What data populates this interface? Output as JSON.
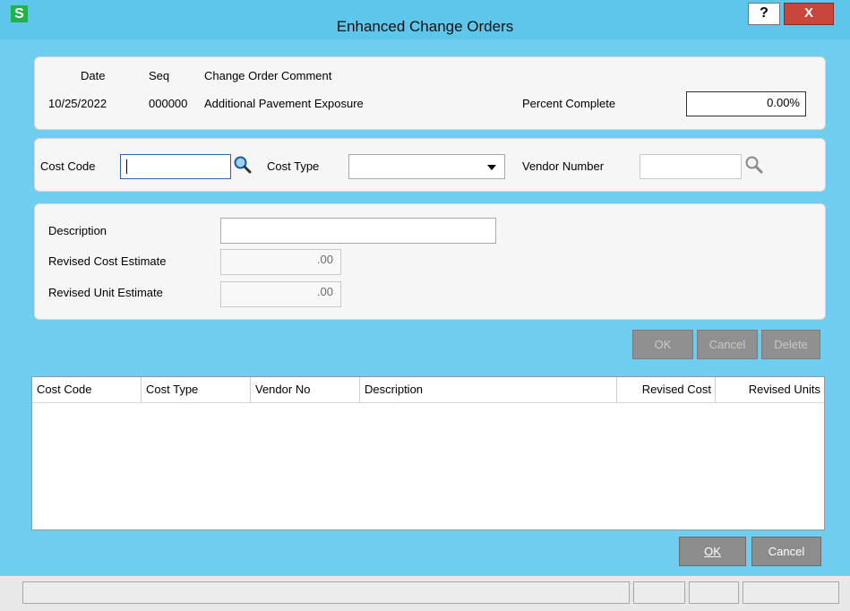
{
  "window": {
    "title": "Enhanced Change Orders",
    "app_icon": "S",
    "help": "?",
    "close": "X"
  },
  "header": {
    "col_date": "Date",
    "col_seq": "Seq",
    "col_comment": "Change Order Comment",
    "date": "10/25/2022",
    "seq": "000000",
    "comment": "Additional Pavement Exposure",
    "percent_label": "Percent Complete",
    "percent_value": "0.00%"
  },
  "filters": {
    "cost_code_label": "Cost Code",
    "cost_code_value": "",
    "cost_type_label": "Cost Type",
    "cost_type_value": "",
    "vendor_label": "Vendor Number",
    "vendor_value": ""
  },
  "detail": {
    "description_label": "Description",
    "description_value": "",
    "revised_cost_label": "Revised Cost Estimate",
    "revised_cost_value": ".00",
    "revised_unit_label": "Revised Unit Estimate",
    "revised_unit_value": ".00"
  },
  "line_buttons": {
    "ok": "OK",
    "cancel": "Cancel",
    "delete": "Delete"
  },
  "grid": {
    "columns": [
      "Cost Code",
      "Cost Type",
      "Vendor No",
      "Description",
      "Revised Cost",
      "Revised Units"
    ],
    "rows": []
  },
  "footer_buttons": {
    "ok": "OK",
    "cancel": "Cancel"
  },
  "icons": {
    "search": "search-icon",
    "dropdown": "chevron-down-icon"
  }
}
